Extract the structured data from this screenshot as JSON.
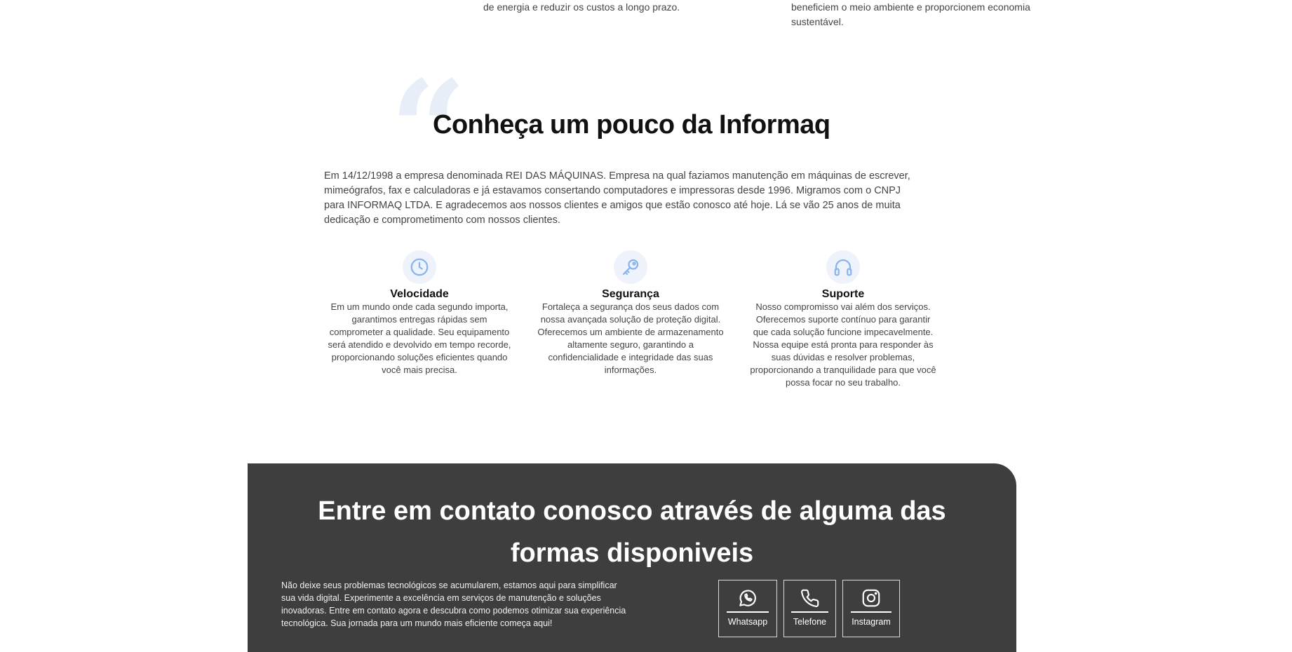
{
  "top": {
    "left_text": "de energia e reduzir os custos a longo prazo.",
    "right_text": "beneficiem o meio ambiente e proporcionem economia sustentável."
  },
  "about": {
    "quote_glyph": "“",
    "title": "Conheça um pouco da Informaq",
    "text": "Em 14/12/1998 a empresa denominada REI DAS MÁQUINAS. Empresa na qual faziamos manutenção em máquinas de escrever, mimeógrafos, fax e calculadoras e já estavamos consertando computadores e impressoras desde 1996. Migramos com o CNPJ para INFORMAQ LTDA. E agradecemos aos nossos clientes e amigos que estão conosco até hoje. Lá se vão 25 anos de muita dedicação e comprometimento com nossos clientes."
  },
  "features": [
    {
      "icon": "clock-icon",
      "title": "Velocidade",
      "desc": "Em um mundo onde cada segundo importa, garantimos entregas rápidas sem comprometer a qualidade. Seu equipamento será atendido e devolvido em tempo recorde, proporcionando soluções eficientes quando você mais precisa."
    },
    {
      "icon": "key-icon",
      "title": "Segurança",
      "desc": "Fortaleça a segurança dos seus dados com nossa avançada solução de proteção digital. Oferecemos um ambiente de armazenamento altamente seguro, garantindo a confidencialidade e integridade das suas informações."
    },
    {
      "icon": "headphones-icon",
      "title": "Suporte",
      "desc": "Nosso compromisso vai além dos serviços. Oferecemos suporte contínuo para garantir que cada solução funcione impecavelmente. Nossa equipe está pronta para responder às suas dúvidas e resolver problemas, proporcionando a tranquilidade para que você possa focar no seu trabalho."
    }
  ],
  "contact": {
    "title": "Entre em contato conosco através de alguma das formas disponiveis",
    "text": "Não deixe seus problemas tecnológicos se acumularem, estamos aqui para simplificar sua vida digital. Experimente a excelência em serviços de manutenção e soluções inovadoras. Entre em contato agora e descubra como podemos otimizar sua experiência tecnológica. Sua jornada para um mundo mais eficiente começa aqui!",
    "buttons": [
      {
        "label": "Whatsapp",
        "icon": "whatsapp-icon"
      },
      {
        "label": "Telefone",
        "icon": "phone-icon"
      },
      {
        "label": "Instagram",
        "icon": "instagram-icon"
      }
    ]
  },
  "colors": {
    "icon_accent": "#8ab4ee",
    "icon_bg": "#eef3fb",
    "contact_bg": "#3e3e3e"
  }
}
